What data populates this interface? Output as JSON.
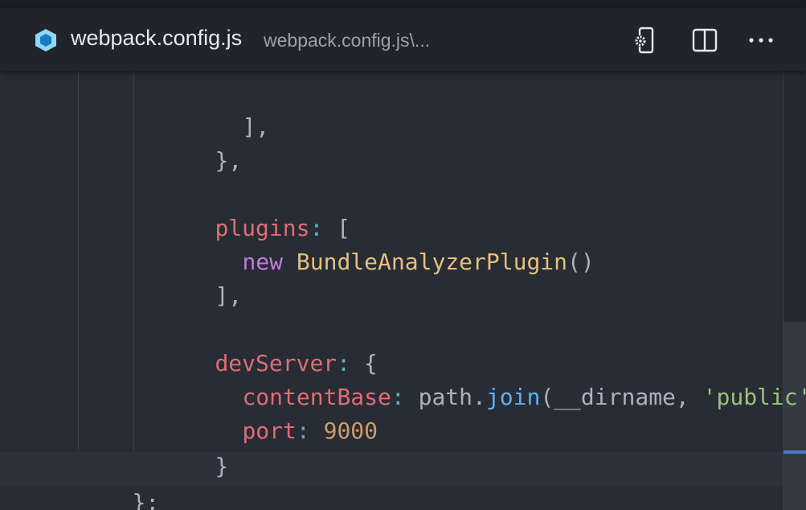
{
  "tab": {
    "title": "webpack.config.js",
    "breadcrumb": "webpack.config.js\\..."
  },
  "icons": {
    "file": "webpack-cube-icon",
    "settings": "open-settings-icon",
    "split": "split-editor-icon",
    "more": "more-actions-icon"
  },
  "colors": {
    "editor_bg": "#282c34",
    "tabbar_bg": "#21252b",
    "property": "#e06c75",
    "keyword": "#c678dd",
    "class": "#e5c07b",
    "function": "#61afef",
    "string": "#98c379",
    "number": "#d19a66",
    "operator": "#56b6c2"
  },
  "code": {
    "l1": {
      "p1": "],",
      "hl": ""
    },
    "l2": {
      "p1": "},",
      "hl": ""
    },
    "l3": {
      "prop": "plugins",
      "colon": ":",
      "rest": " ["
    },
    "l4": {
      "kw": "new",
      "cls": "BundleAnalyzerPlugin",
      "rest": "()"
    },
    "l5": {
      "p1": "],"
    },
    "l6": {
      "prop": "devServer",
      "colon": ":",
      "rest": " {"
    },
    "l7": {
      "prop": "contentBase",
      "colon": ":",
      "obj": " path.",
      "fn": "join",
      "args": "(__dirname, ",
      "str": "'public'",
      "rest": "),"
    },
    "l8": {
      "prop": "port",
      "colon": ":",
      "num": "9000"
    },
    "l9": {
      "p1": "}"
    },
    "l10": {
      "p1": "};"
    }
  }
}
